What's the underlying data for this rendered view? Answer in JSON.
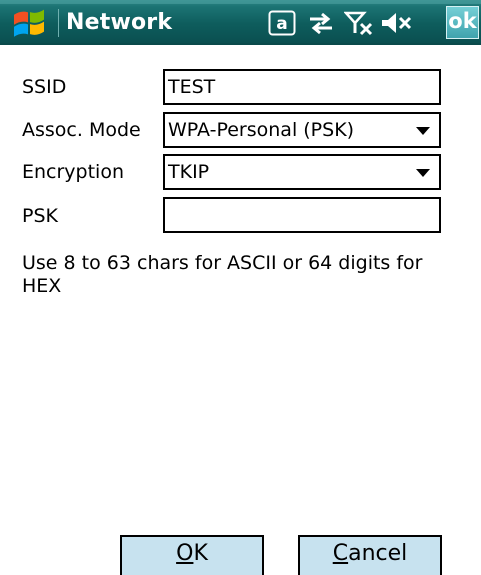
{
  "title_bar": {
    "start_icon": "windows-flag-icon",
    "title": "Network",
    "status_icons": [
      "at-sign-icon",
      "connectivity-arrows-icon",
      "signal-off-icon",
      "speaker-mute-icon"
    ],
    "ok_label": "ok"
  },
  "form": {
    "ssid": {
      "label": "SSID",
      "value": "TEST"
    },
    "assoc_mode": {
      "label": "Assoc. Mode",
      "value": "WPA-Personal (PSK)"
    },
    "encryption": {
      "label": "Encryption",
      "value": "TKIP"
    },
    "psk": {
      "label": "PSK",
      "value": ""
    }
  },
  "help_text": "Use 8 to 63 chars for ASCII or 64 digits for HEX",
  "buttons": {
    "ok_first": "O",
    "ok_rest": "K",
    "cancel_first": "C",
    "cancel_rest": "ancel"
  },
  "colors": {
    "titlebar": "#0e5d5d",
    "ok_button": "#5bbcc4",
    "button_bg": "#c7e2ef"
  }
}
